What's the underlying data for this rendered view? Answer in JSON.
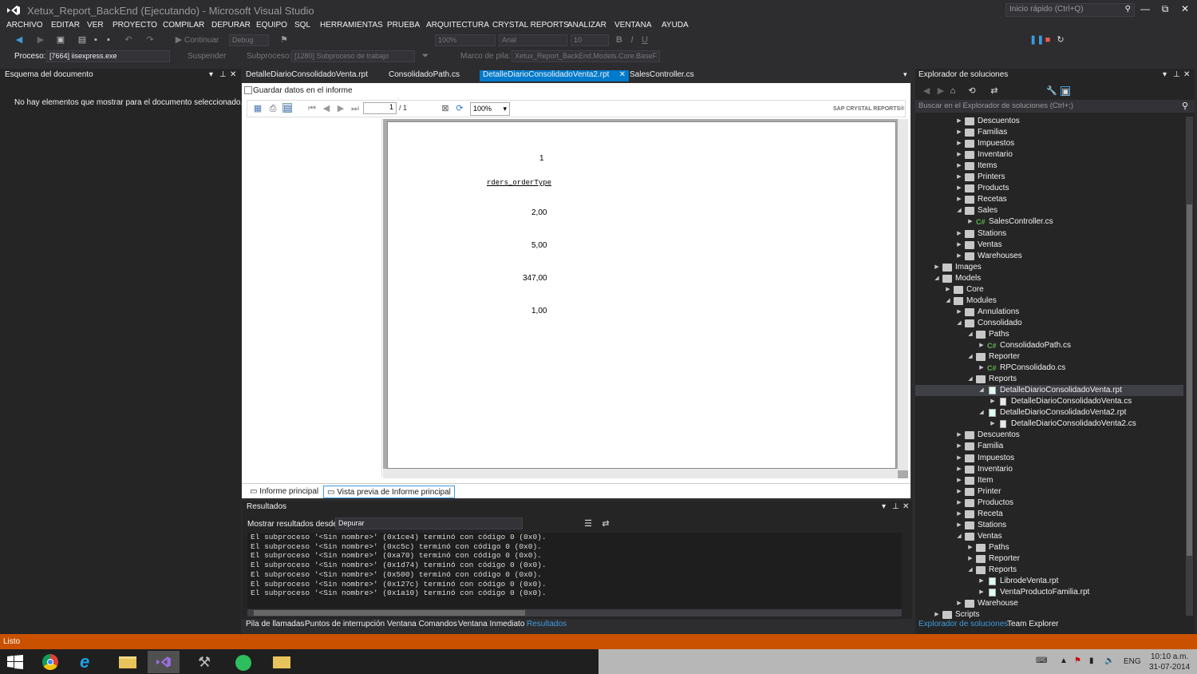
{
  "window": {
    "title": "Xetux_Report_BackEnd (Ejecutando) - Microsoft Visual Studio",
    "quick_launch_placeholder": "Inicio rápido (Ctrl+Q)",
    "minimize": "—",
    "restore": "⧉",
    "close": "✕"
  },
  "menu": [
    "ARCHIVO",
    "EDITAR",
    "VER",
    "PROYECTO",
    "COMPILAR",
    "DEPURAR",
    "EQUIPO",
    "SQL",
    "HERRAMIENTAS",
    "PRUEBA",
    "ARQUITECTURA",
    "CRYSTAL REPORTS",
    "ANALIZAR",
    "VENTANA",
    "AYUDA"
  ],
  "toolbar": {
    "continue_label": "Continuar",
    "config_value": "Debug",
    "zoom_value": "100%",
    "font_value": "Arial",
    "font_size_value": "10"
  },
  "toolbar2": {
    "process_label": "Proceso:",
    "process_value": "[7664] iisexpress.exe",
    "suspend_label": "Suspender",
    "thread_label": "Subproceso:",
    "thread_value": "[1280] Subproceso de trabajo",
    "stack_label": "Marco de pila:",
    "stack_value": "Xetux_Report_BackEnd.Models.Core.BaseF"
  },
  "outline": {
    "title": "Esquema del documento",
    "message": "No hay elementos que mostrar para el documento seleccionado."
  },
  "doc_tabs": [
    {
      "label": "DetalleDiarioConsolidadoVenta.rpt"
    },
    {
      "label": "ConsolidadoPath.cs"
    },
    {
      "label": "DetalleDiarioConsolidadoVenta2.rpt"
    },
    {
      "label": "SalesController.cs"
    }
  ],
  "report_viewer": {
    "save_checkbox_label": "Guardar datos en el informe",
    "page_value": "1",
    "page_total": "/ 1",
    "zoom_value": "100%",
    "brand": "SAP CRYSTAL REPORTS®",
    "content": {
      "count": "1",
      "field": "rders_orderType",
      "values": [
        "2,00",
        "5,00",
        "347,00",
        "1,00"
      ]
    }
  },
  "report_bottom_tabs": [
    "Informe principal",
    "Vista previa de Informe principal"
  ],
  "results": {
    "title": "Resultados",
    "show_from_label": "Mostrar resultados desde:",
    "show_from_value": "Depurar",
    "lines": [
      "El subproceso '<Sin nombre>' (0x1ce4) terminó con código 0 (0x0).",
      "El subproceso '<Sin nombre>' (0xc5c) terminó con código 0 (0x0).",
      "El subproceso '<Sin nombre>' (0xa70) terminó con código 0 (0x0).",
      "El subproceso '<Sin nombre>' (0x1d74) terminó con código 0 (0x0).",
      "El subproceso '<Sin nombre>' (0x500) terminó con código 0 (0x0).",
      "El subproceso '<Sin nombre>' (0x127c) terminó con código 0 (0x0).",
      "El subproceso '<Sin nombre>' (0x1a10) terminó con código 0 (0x0)."
    ]
  },
  "lower_tabs": [
    "Pila de llamadas",
    "Puntos de interrupción",
    "Ventana Comandos",
    "Ventana Inmediato",
    "Resultados"
  ],
  "explorer": {
    "title": "Explorador de soluciones",
    "search_placeholder": "Buscar en el Explorador de soluciones (Ctrl+;)",
    "tabs": [
      "Explorador de soluciones",
      "Team Explorer"
    ],
    "tree": [
      {
        "label": "Descuentos",
        "type": "folder",
        "arrow": "▶",
        "level": 4
      },
      {
        "label": "Familias",
        "type": "folder",
        "arrow": "▶",
        "level": 4
      },
      {
        "label": "Impuestos",
        "type": "folder",
        "arrow": "▶",
        "level": 4
      },
      {
        "label": "Inventario",
        "type": "folder",
        "arrow": "▶",
        "level": 4
      },
      {
        "label": "Items",
        "type": "folder",
        "arrow": "▶",
        "level": 4
      },
      {
        "label": "Printers",
        "type": "folder",
        "arrow": "▶",
        "level": 4
      },
      {
        "label": "Products",
        "type": "folder",
        "arrow": "▶",
        "level": 4
      },
      {
        "label": "Recetas",
        "type": "folder",
        "arrow": "▶",
        "level": 4
      },
      {
        "label": "Sales",
        "type": "folder",
        "arrow": "◢",
        "level": 4
      },
      {
        "label": "SalesController.cs",
        "type": "cs",
        "arrow": "▶",
        "level": 5
      },
      {
        "label": "Stations",
        "type": "folder",
        "arrow": "▶",
        "level": 4
      },
      {
        "label": "Ventas",
        "type": "folder",
        "arrow": "▶",
        "level": 4
      },
      {
        "label": "Warehouses",
        "type": "folder",
        "arrow": "▶",
        "level": 4
      },
      {
        "label": "Images",
        "type": "folder",
        "arrow": "▶",
        "level": 2
      },
      {
        "label": "Models",
        "type": "folder",
        "arrow": "◢",
        "level": 2
      },
      {
        "label": "Core",
        "type": "folder",
        "arrow": "▶",
        "level": 3
      },
      {
        "label": "Modules",
        "type": "folder",
        "arrow": "◢",
        "level": 3
      },
      {
        "label": "Annulations",
        "type": "folder",
        "arrow": "▶",
        "level": 4
      },
      {
        "label": "Consolidado",
        "type": "folder",
        "arrow": "◢",
        "level": 4
      },
      {
        "label": "Paths",
        "type": "folder",
        "arrow": "◢",
        "level": 5
      },
      {
        "label": "ConsolidadoPath.cs",
        "type": "cs",
        "arrow": "▶",
        "level": 6
      },
      {
        "label": "Reporter",
        "type": "folder",
        "arrow": "◢",
        "level": 5
      },
      {
        "label": "RPConsolidado.cs",
        "type": "cs",
        "arrow": "▶",
        "level": 6
      },
      {
        "label": "Reports",
        "type": "folder",
        "arrow": "◢",
        "level": 5
      },
      {
        "label": "DetalleDiarioConsolidadoVenta.rpt",
        "type": "rpt",
        "arrow": "◢",
        "level": 6,
        "selected": true
      },
      {
        "label": "DetalleDiarioConsolidadoVenta.cs",
        "type": "doc",
        "arrow": "▶",
        "level": 7
      },
      {
        "label": "DetalleDiarioConsolidadoVenta2.rpt",
        "type": "rpt",
        "arrow": "◢",
        "level": 6
      },
      {
        "label": "DetalleDiarioConsolidadoVenta2.cs",
        "type": "doc",
        "arrow": "▶",
        "level": 7
      },
      {
        "label": "Descuentos",
        "type": "folder",
        "arrow": "▶",
        "level": 4
      },
      {
        "label": "Familia",
        "type": "folder",
        "arrow": "▶",
        "level": 4
      },
      {
        "label": "Impuestos",
        "type": "folder",
        "arrow": "▶",
        "level": 4
      },
      {
        "label": "Inventario",
        "type": "folder",
        "arrow": "▶",
        "level": 4
      },
      {
        "label": "Item",
        "type": "folder",
        "arrow": "▶",
        "level": 4
      },
      {
        "label": "Printer",
        "type": "folder",
        "arrow": "▶",
        "level": 4
      },
      {
        "label": "Productos",
        "type": "folder",
        "arrow": "▶",
        "level": 4
      },
      {
        "label": "Receta",
        "type": "folder",
        "arrow": "▶",
        "level": 4
      },
      {
        "label": "Stations",
        "type": "folder",
        "arrow": "▶",
        "level": 4
      },
      {
        "label": "Ventas",
        "type": "folder",
        "arrow": "◢",
        "level": 4
      },
      {
        "label": "Paths",
        "type": "folder",
        "arrow": "▶",
        "level": 5
      },
      {
        "label": "Reporter",
        "type": "folder",
        "arrow": "▶",
        "level": 5
      },
      {
        "label": "Reports",
        "type": "folder",
        "arrow": "◢",
        "level": 5
      },
      {
        "label": "LibrodeVenta.rpt",
        "type": "rpt",
        "arrow": "▶",
        "level": 6
      },
      {
        "label": "VentaProductoFamilia.rpt",
        "type": "rpt",
        "arrow": "▶",
        "level": 6
      },
      {
        "label": "Warehouse",
        "type": "folder",
        "arrow": "▶",
        "level": 4
      },
      {
        "label": "Scripts",
        "type": "folder",
        "arrow": "▶",
        "level": 2
      }
    ]
  },
  "status": {
    "text": "Listo"
  },
  "taskbar": {
    "time": "10:10 a.m.",
    "date": "31-07-2014",
    "language": "ENG"
  }
}
